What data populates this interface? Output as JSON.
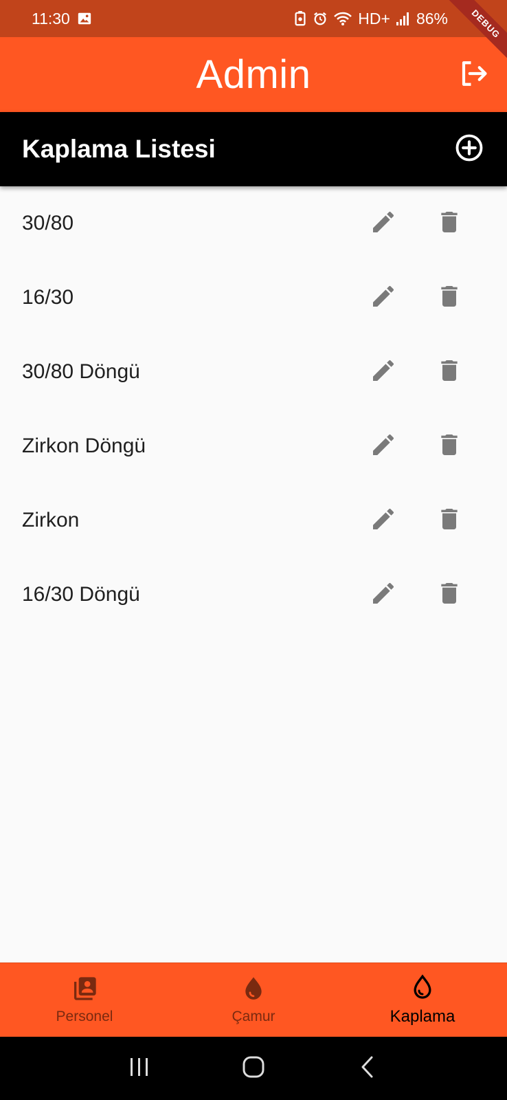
{
  "status_bar": {
    "time": "11:30",
    "battery": "86%",
    "network": "HD+",
    "debug_banner": "DEBUG"
  },
  "app_bar": {
    "title": "Admin",
    "logout_icon": "logout-icon"
  },
  "section": {
    "title": "Kaplama Listesi",
    "add_icon": "add-circle-icon"
  },
  "items": [
    {
      "label": "30/80"
    },
    {
      "label": "16/30"
    },
    {
      "label": "30/80 Döngü"
    },
    {
      "label": "Zirkon Döngü"
    },
    {
      "label": "Zirkon"
    },
    {
      "label": "16/30 Döngü"
    }
  ],
  "bottom_nav": {
    "items": [
      {
        "label": "Personel",
        "icon": "contacts-icon",
        "active": false
      },
      {
        "label": "Çamur",
        "icon": "drop-icon",
        "active": false
      },
      {
        "label": "Kaplama",
        "icon": "drop-outline-icon",
        "active": true
      }
    ]
  },
  "colors": {
    "primary": "#ff5722",
    "status_bar": "#c1441b",
    "header": "#000000",
    "icon_grey": "#7a7a7a",
    "nav_inactive": "#7a2a10"
  }
}
